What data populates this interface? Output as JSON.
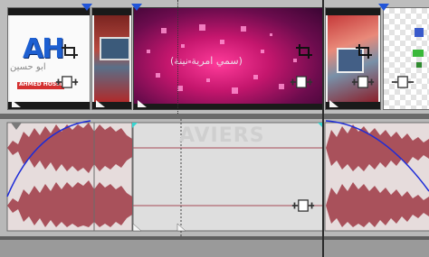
{
  "timeline": {
    "clip_1_logo_text": "AH",
    "clip_1_logo_subtext": "ابو حسين",
    "clip_1_tagline": "AHMED HOSSIEN",
    "clip_3_caption": "(سمي امرية نينة)",
    "audio_watermark": "AVIERS"
  },
  "colors": {
    "video_track_bg": "#bdbdbd",
    "audio_clip_bg": "#e6dcdc",
    "waveform": "#a64a55",
    "fade_curve": "#1c2bd8",
    "marker": "#2255d8",
    "cyan_marker": "#35d4d0"
  }
}
